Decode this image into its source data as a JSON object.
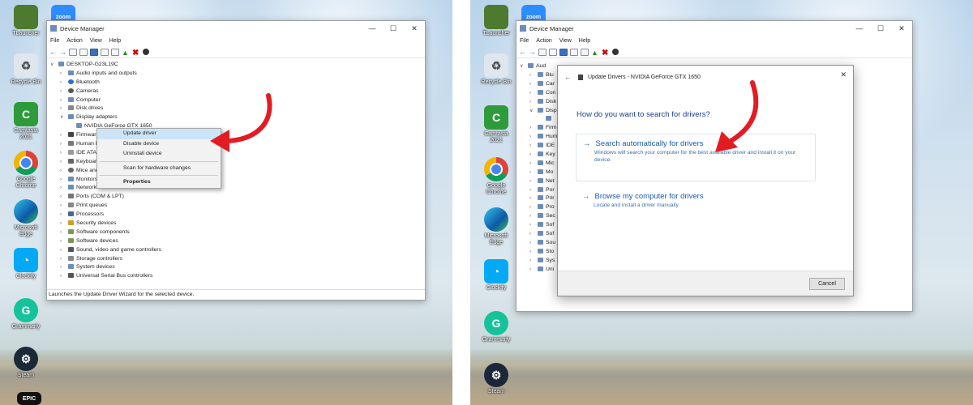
{
  "desktop_icons": [
    {
      "label": "TLauncher",
      "name": "tlauncher-icon"
    },
    {
      "label": "zoom",
      "name": "zoom-icon"
    },
    {
      "label": "Recycle Bin",
      "name": "recycle-bin-icon"
    },
    {
      "label": "Camtasia 2021",
      "name": "camtasia-icon"
    },
    {
      "label": "Google Chrome",
      "name": "chrome-icon"
    },
    {
      "label": "Microsoft Edge",
      "name": "edge-icon"
    },
    {
      "label": "Clockify",
      "name": "clockify-icon"
    },
    {
      "label": "Grammarly",
      "name": "grammarly-icon"
    },
    {
      "label": "Steam",
      "name": "steam-icon"
    },
    {
      "label": "EPIC",
      "name": "epic-icon"
    }
  ],
  "device_manager": {
    "title": "Device Manager",
    "menu": [
      "File",
      "Action",
      "View",
      "Help"
    ],
    "root": "DESKTOP-G23L19C",
    "tree": [
      "Audio inputs and outputs",
      "Bluetooth",
      "Cameras",
      "Computer",
      "Disk drives",
      "Display adapters",
      "NVIDIA GeForce GTX 1650",
      "Firmware",
      "Human Interface Devices",
      "IDE ATA/ATAPI controllers",
      "Keyboards",
      "Mice and other pointing devices",
      "Monitors",
      "Network adapters",
      "Ports (COM & LPT)",
      "Print queues",
      "Processors",
      "Security devices",
      "Software components",
      "Software devices",
      "Sound, video and game controllers",
      "Storage controllers",
      "System devices",
      "Universal Serial Bus controllers"
    ],
    "tree_left_partial": [
      "Firmware",
      "Human Inte",
      "IDE ATA/",
      "Keyboards",
      "Mice and ot",
      "Monitors",
      "Network ad"
    ],
    "tree_right_partial": [
      "Aud",
      "Blu",
      "Car",
      "Con",
      "Disk",
      "Disp",
      "",
      "Firm",
      "Hum",
      "IDE",
      "Key",
      "Mic",
      "Mo",
      "Net",
      "Por",
      "Prir",
      "Pro",
      "Sec",
      "Sof",
      "Sof",
      "Sou",
      "Sto",
      "Sys",
      "Uni"
    ],
    "status": "Launches the Update Driver Wizard for the selected device."
  },
  "context_menu": {
    "items": [
      "Update driver",
      "Disable device",
      "Uninstall device",
      "Scan for hardware changes",
      "Properties"
    ]
  },
  "update_dialog": {
    "title": "Update Drivers - NVIDIA GeForce GTX 1650",
    "question": "How do you want to search for drivers?",
    "option1_title": "Search automatically for drivers",
    "option1_desc": "Windows will search your computer for the best available driver and install it on your device.",
    "option2_title": "Browse my computer for drivers",
    "option2_desc": "Locate and install a driver manually.",
    "cancel": "Cancel"
  },
  "colors": {
    "link": "#1b5aa8",
    "arrow": "#e31b23",
    "highlight": "#cce4f7"
  }
}
